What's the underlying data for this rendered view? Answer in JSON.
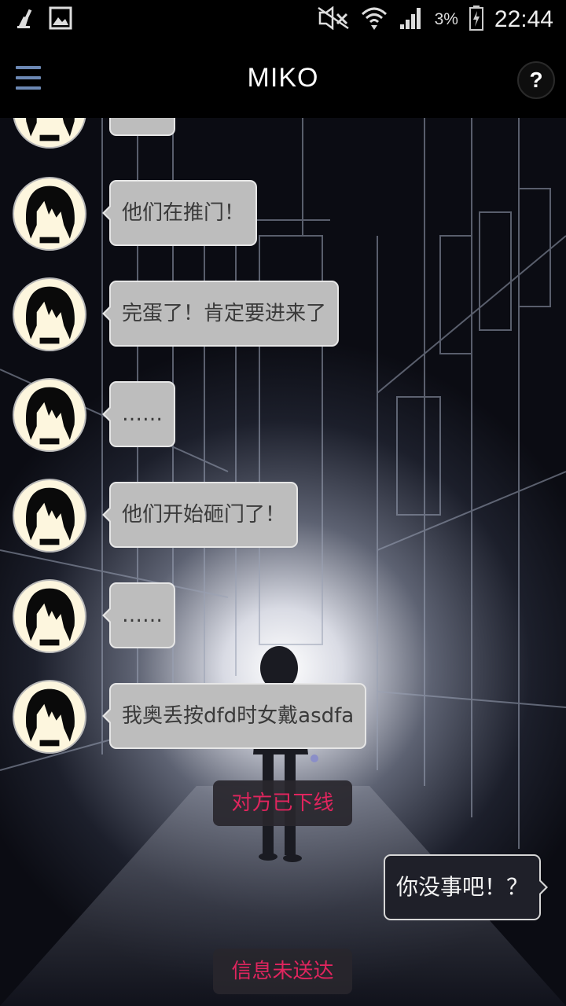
{
  "status_bar": {
    "time": "22:44",
    "battery_percent": "3%",
    "icons": [
      "cleaner-icon",
      "gallery-icon",
      "mute-icon",
      "wifi-icon",
      "signal-icon",
      "battery-icon"
    ]
  },
  "app_bar": {
    "title": "MIKO",
    "menu_icon": "hamburger-icon",
    "help_label": "?"
  },
  "chat": {
    "messages": [
      {
        "from": "miko",
        "text": "……"
      },
      {
        "from": "miko",
        "text": "他们在推门！"
      },
      {
        "from": "miko",
        "text": "完蛋了！肯定要进来了"
      },
      {
        "from": "miko",
        "text": "……"
      },
      {
        "from": "miko",
        "text": "他们开始砸门了！"
      },
      {
        "from": "miko",
        "text": "……"
      },
      {
        "from": "miko",
        "text": "我奥丢按dfd时女戴asdfa"
      }
    ],
    "notice_offline": "对方已下线",
    "outgoing_message": "你没事吧！？",
    "notice_undelivered": "信息未送达"
  },
  "colors": {
    "notice_text": "#e0255e",
    "incoming_bubble": "#bdbdbd",
    "outgoing_bubble": "#1f2029",
    "menu_icon": "#6c88b4"
  }
}
